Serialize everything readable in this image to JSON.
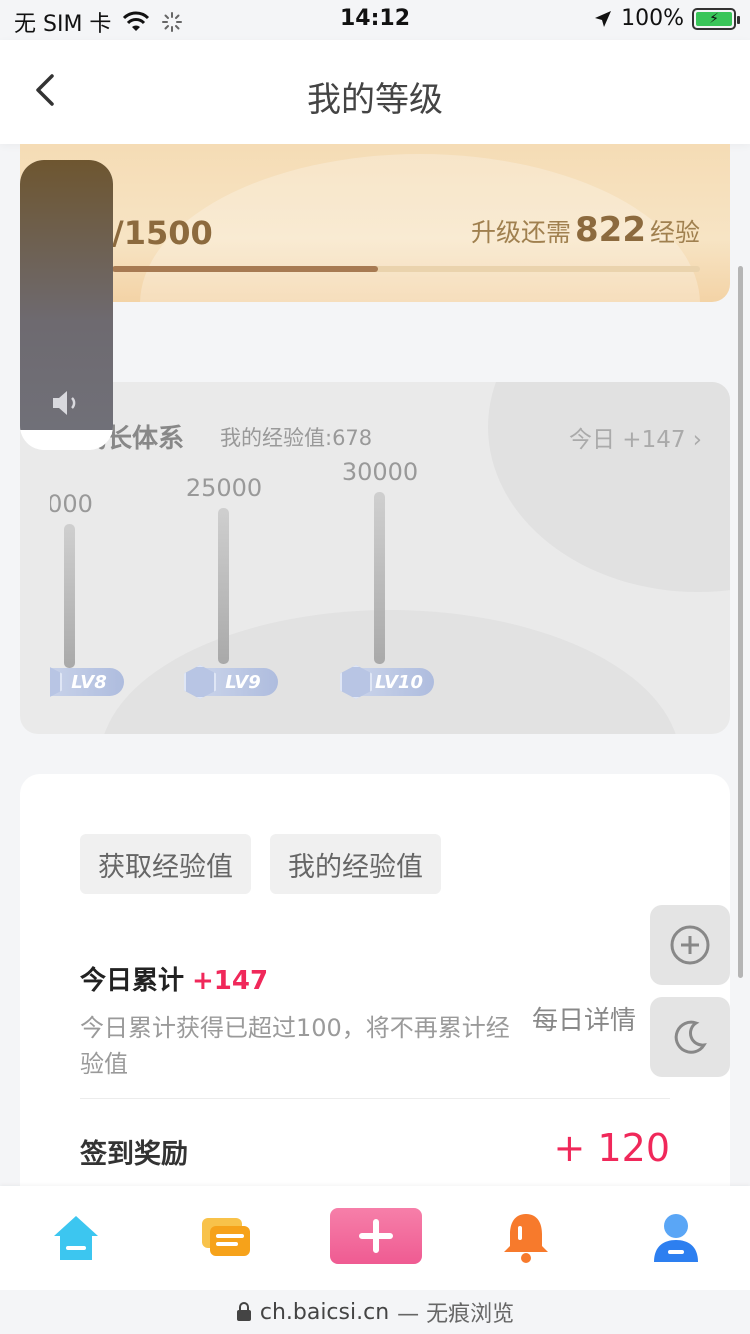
{
  "status_bar": {
    "carrier": "无 SIM 卡",
    "time": "14:12",
    "battery": "100%"
  },
  "nav": {
    "title": "我的等级",
    "back_icon": "chevron-left-icon"
  },
  "level_card": {
    "progress_text": "/1500",
    "need_prefix": "升级还需",
    "need_value": "822",
    "need_suffix": "经验",
    "progress_fraction": 0.452
  },
  "growth": {
    "title": "成长体系",
    "my_exp": "我的经验值:678",
    "today": "今日 +147",
    "levels": [
      {
        "value": "000",
        "badge": "LV8"
      },
      {
        "value": "25000",
        "badge": "LV9"
      },
      {
        "value": "30000",
        "badge": "LV10"
      }
    ]
  },
  "exp_card": {
    "tabs": [
      "获取经验值",
      "我的经验值"
    ],
    "today_label": "今日累计",
    "today_value": "+147",
    "today_desc": "今日累计获得已超过100，将不再累计经验值",
    "daily_detail": "每日详情",
    "signin_label": "签到奖励",
    "signin_value": "+ 120"
  },
  "url_bar": {
    "domain": "ch.baicsi.cn",
    "suffix": "— 无痕浏览"
  },
  "colors": {
    "accent_red": "#f0285a",
    "gold": "#8c6a3e",
    "home_blue": "#3cc6f0",
    "chat_orange": "#f6a21a",
    "add_pink": "#f2679b",
    "bell_orange": "#f77a2c",
    "user_blue": "#2d7ff0"
  }
}
